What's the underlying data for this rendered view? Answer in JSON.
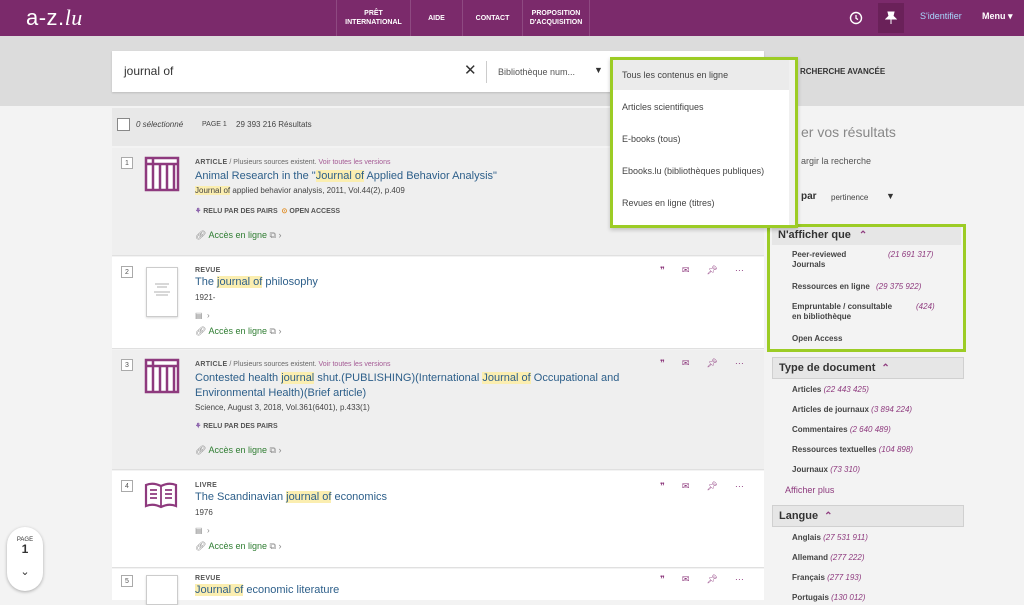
{
  "header": {
    "logo": "a-z.lu",
    "nav": [
      {
        "line1": "PRÊT",
        "line2": "INTERNATIONAL"
      },
      {
        "line1": "AIDE",
        "line2": ""
      },
      {
        "line1": "CONTACT",
        "line2": ""
      },
      {
        "line1": "PROPOSITION",
        "line2": "D'ACQUISITION"
      }
    ],
    "signin": "S'identifier",
    "menu": "Menu",
    "history_icon": "history-icon",
    "pin_icon": "pin-icon"
  },
  "search": {
    "query": "journal of",
    "scope": "Bibliothèque num...",
    "advanced": "RCHERCHE AVANCÉE"
  },
  "scope_dropdown": {
    "options": [
      "Tous les contenus en ligne",
      "Articles scientifiques",
      "E-books (tous)",
      "Ebooks.lu (bibliothèques publiques)",
      "Revues en ligne (titres)"
    ]
  },
  "results_bar": {
    "selected": "0 sélectionné",
    "page": "PAGE 1",
    "count": "29 393 216 Résultats"
  },
  "results": [
    {
      "num": "1",
      "type": "ARTICLE",
      "meta_extra": " / Plusieurs sources existent. ",
      "meta_link": "Voir toutes les versions",
      "title_pre": "Animal Research in the \"",
      "title_hl": "Journal of",
      "title_post": " Applied Behavior Analysis\"",
      "sub_hl": "Journal of",
      "sub_post": " applied behavior analysis, 2011, Vol.44(2), p.409",
      "badge1": "RELU PAR DES PAIRS",
      "badge2": "OPEN ACCESS",
      "access": "Accès en ligne"
    },
    {
      "num": "2",
      "type": "REVUE",
      "title_pre": "The ",
      "title_hl": "journal of",
      "title_post": " philosophy",
      "sub": "1921-",
      "access": "Accès en ligne"
    },
    {
      "num": "3",
      "type": "ARTICLE",
      "meta_extra": " / Plusieurs sources existent. ",
      "meta_link": "Voir toutes les versions",
      "title_a": "Contested health ",
      "title_hl1": "journal",
      "title_b": " shut.(PUBLISHING)(International ",
      "title_hl2": "Journal of",
      "title_c": " Occupational and",
      "title_line2": "Environmental Health)(Brief article)",
      "sub": "Science, August 3, 2018, Vol.361(6401), p.433(1)",
      "badge1": "RELU PAR DES PAIRS",
      "access": "Accès en ligne"
    },
    {
      "num": "4",
      "type": "LIVRE",
      "title_pre": "The Scandinavian ",
      "title_hl": "journal of",
      "title_post": " economics",
      "sub": "1976",
      "access": "Accès en ligne"
    },
    {
      "num": "5",
      "type": "REVUE",
      "title_pre": "",
      "title_hl": "Journal of",
      "title_post": " economic literature"
    }
  ],
  "sidebar": {
    "title": "er vos résultats",
    "enlarge": "argir la recherche",
    "sort_label": "par",
    "sort_value": "pertinence",
    "facet_show_only": {
      "heading": "N'afficher que",
      "items": [
        {
          "line1": "Peer-reviewed",
          "line2": "Journals",
          "count": "(21 691 317)"
        },
        {
          "line1": "Ressources en ligne",
          "line2": "",
          "count": "(29 375 922)"
        },
        {
          "line1": "Empruntable / consultable",
          "line2": "en bibliothèque",
          "count": "(424)"
        },
        {
          "line1": "Open Access",
          "line2": "",
          "count": ""
        }
      ]
    },
    "facet_doc_type": {
      "heading": "Type de document",
      "items": [
        {
          "label": "Articles",
          "count": "(22 443 425)"
        },
        {
          "label": "Articles de journaux",
          "count": "(3 894 224)"
        },
        {
          "label": "Commentaires",
          "count": "(2 640 489)"
        },
        {
          "label": "Ressources textuelles",
          "count": "(104 898)"
        },
        {
          "label": "Journaux",
          "count": "(73 310)"
        }
      ],
      "more": "Afficher plus"
    },
    "facet_lang": {
      "heading": "Langue",
      "items": [
        {
          "label": "Anglais",
          "count": "(27 531 911)"
        },
        {
          "label": "Allemand",
          "count": "(277 222)"
        },
        {
          "label": "Français",
          "count": "(277 193)"
        },
        {
          "label": "Portugais",
          "count": "(130 012)"
        }
      ]
    }
  },
  "pager": {
    "label": "PAGE",
    "number": "1"
  },
  "colors": {
    "brand": "#7b2a6b",
    "highlight_border": "#9ccc25",
    "link": "#2d5f8a",
    "accent": "#8e3a7e"
  }
}
